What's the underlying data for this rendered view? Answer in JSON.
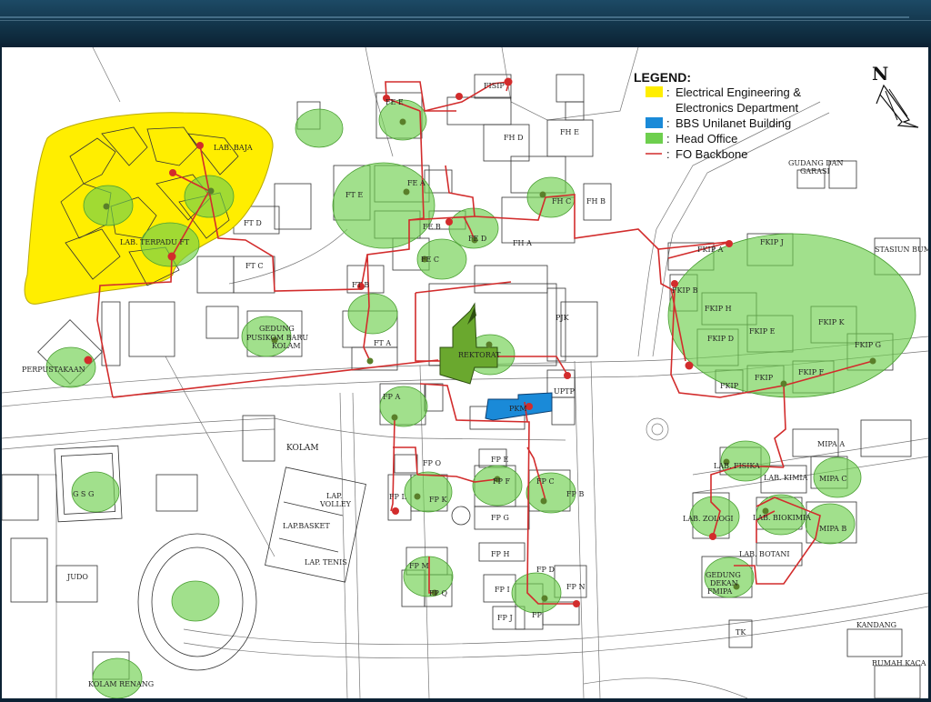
{
  "map": {
    "legend": {
      "title": "LEGEND:",
      "items": [
        {
          "color": "#ffee00",
          "label_line1": "Electrical Engineering &",
          "label_line2": "Electronics Department"
        },
        {
          "color": "#1a8ad8",
          "label_line1": "BBS Unilanet Building"
        },
        {
          "color": "#6ecf4e",
          "label_line1": "Head Office"
        },
        {
          "color": "#d22c2c",
          "label_line1": "FO Backbone",
          "symbol": "line"
        }
      ]
    },
    "north_label": "N",
    "colors": {
      "ee_zone": "#ffee00",
      "bbs": "#1a8ad8",
      "head_office": "#6ecf4e",
      "fo_backbone": "#d22c2c"
    },
    "labels": {
      "lab_baja": "LAB. BAJA",
      "lab_terpadu": "LAB. TERPADU  FT",
      "ft_d": "FT D",
      "ft_c": "FT C",
      "ft_e": "FT E",
      "ft_b": "FT B",
      "ft_a": "FT A",
      "fe_e": "FE E",
      "fe_a": "FE A",
      "fe_b": "FE B",
      "fe_c": "FE C",
      "fe_d": "FE D",
      "fisip": "FISIP",
      "fh_d": "FH D",
      "fh_e": "FH E",
      "fh_c": "FH C",
      "fh_b": "FH B",
      "fh_a": "FH A",
      "gudang": "GUDANG  DAN",
      "garasi": "GARASI",
      "stasiun": "STASIUN  BUMI",
      "gedung_pusikom1": "GEDUNG",
      "gedung_pusikom2": "PUSIKOM BARU",
      "kolam1": "KOLAM",
      "perpustakaan": "PERPUSTAKAAN",
      "pjk": "PJK",
      "rektorat": "REKTORAT",
      "uptp": "UPTP",
      "pkm": "PKM",
      "fkip_a": "FKIP A",
      "fkip_j": "FKIP J",
      "fkip_b": "FKIP B",
      "fkip_h": "FKIP H",
      "fkip_e": "FKIP E",
      "fkip_k": "FKIP K",
      "fkip_d": "FKIP D",
      "fkip_g": "FKIP G",
      "fkip_f": "FKIP F",
      "fkip_c": "FKIP",
      "fkip_c2": "FKIP",
      "fp_a": "FP A",
      "fp_o": "FP O",
      "fp_e": "FP E",
      "fp_l": "FP L",
      "fp_k": "FP K",
      "fp_f": "FP F",
      "fp_c": "FP C",
      "fp_b": "FP B",
      "fp_g": "FP G",
      "fp_h": "FP H",
      "fp_m": "FP M",
      "fp_q": "FP Q",
      "fp_d": "FP D",
      "fp_i": "FP I",
      "fp_n": "FP N",
      "fp_j": "FP J",
      "fp_fp": "FP",
      "kolam2": "KOLAM",
      "gsg": "G  S  G",
      "lap_volley1": "LAP.",
      "lap_volley2": "VOLLEY",
      "lap_basket": "LAP.BASKET",
      "lap_tenis": "LAP.  TENIS",
      "judo": "JUDO",
      "kolam_renang": "KOLAM  RENANG",
      "mipa_a": "MIPA  A",
      "lab_fisika": "LAB. FISIKA",
      "lab_kimia": "LAB. KIMIA",
      "mipa_c": "MIPA  C",
      "lab_zoologi": "LAB. ZOLOGI",
      "lab_biokimia": "LAB. BIOKIMIA",
      "mipa_b": "MIPA  B",
      "lab_botani": "LAB. BOTANI",
      "gedung_dekan1": "GEDUNG",
      "gedung_dekan2": "DEKAN",
      "gedung_dekan3": "FMIPA",
      "tk": "TK",
      "kandang": "KANDANG",
      "rumah_kaca": "RUMAH  KACA"
    }
  }
}
